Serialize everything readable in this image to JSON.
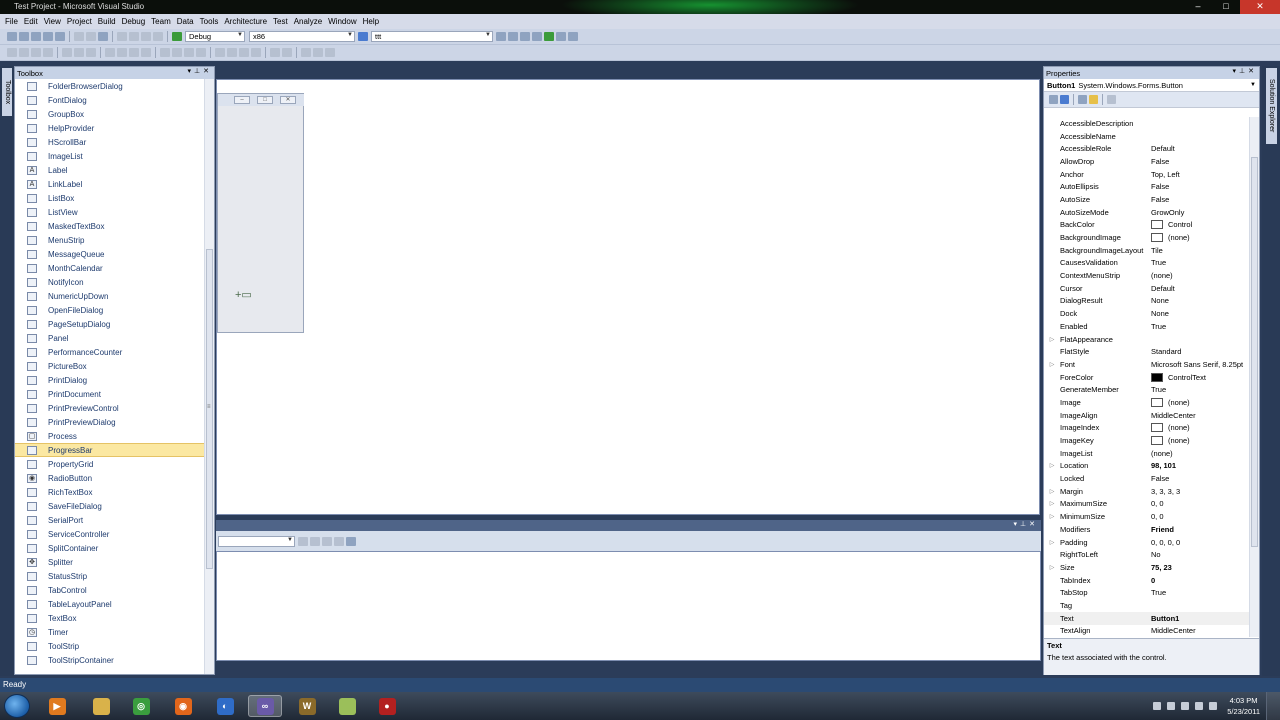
{
  "window": {
    "title": "Test Project - Microsoft Visual Studio"
  },
  "menu": [
    "File",
    "Edit",
    "View",
    "Project",
    "Build",
    "Debug",
    "Team",
    "Data",
    "Tools",
    "Architecture",
    "Test",
    "Analyze",
    "Window",
    "Help"
  ],
  "toolbar": {
    "config": "Debug",
    "platform": "x86",
    "find": "ttt"
  },
  "left_tab": "Toolbox",
  "toolbox": {
    "title": "Toolbox",
    "selected": "ProgressBar",
    "items": [
      {
        "label": "FolderBrowserDialog",
        "icon": "folder-browser-icon"
      },
      {
        "label": "FontDialog",
        "icon": "font-dialog-icon"
      },
      {
        "label": "GroupBox",
        "icon": "groupbox-icon"
      },
      {
        "label": "HelpProvider",
        "icon": "help-provider-icon"
      },
      {
        "label": "HScrollBar",
        "icon": "hscrollbar-icon"
      },
      {
        "label": "ImageList",
        "icon": "imagelist-icon"
      },
      {
        "label": "Label",
        "icon": "label-icon"
      },
      {
        "label": "LinkLabel",
        "icon": "linklabel-icon"
      },
      {
        "label": "ListBox",
        "icon": "listbox-icon"
      },
      {
        "label": "ListView",
        "icon": "listview-icon"
      },
      {
        "label": "MaskedTextBox",
        "icon": "masked-textbox-icon"
      },
      {
        "label": "MenuStrip",
        "icon": "menustrip-icon"
      },
      {
        "label": "MessageQueue",
        "icon": "message-queue-icon"
      },
      {
        "label": "MonthCalendar",
        "icon": "month-calendar-icon"
      },
      {
        "label": "NotifyIcon",
        "icon": "notify-icon-icon"
      },
      {
        "label": "NumericUpDown",
        "icon": "numeric-updown-icon"
      },
      {
        "label": "OpenFileDialog",
        "icon": "open-file-dialog-icon"
      },
      {
        "label": "PageSetupDialog",
        "icon": "page-setup-dialog-icon"
      },
      {
        "label": "Panel",
        "icon": "panel-icon"
      },
      {
        "label": "PerformanceCounter",
        "icon": "performance-counter-icon"
      },
      {
        "label": "PictureBox",
        "icon": "picturebox-icon"
      },
      {
        "label": "PrintDialog",
        "icon": "print-dialog-icon"
      },
      {
        "label": "PrintDocument",
        "icon": "print-document-icon"
      },
      {
        "label": "PrintPreviewControl",
        "icon": "print-preview-control-icon"
      },
      {
        "label": "PrintPreviewDialog",
        "icon": "print-preview-dialog-icon"
      },
      {
        "label": "Process",
        "icon": "process-icon"
      },
      {
        "label": "ProgressBar",
        "icon": "progressbar-icon"
      },
      {
        "label": "PropertyGrid",
        "icon": "property-grid-icon"
      },
      {
        "label": "RadioButton",
        "icon": "radio-button-icon"
      },
      {
        "label": "RichTextBox",
        "icon": "rich-textbox-icon"
      },
      {
        "label": "SaveFileDialog",
        "icon": "save-file-dialog-icon"
      },
      {
        "label": "SerialPort",
        "icon": "serial-port-icon"
      },
      {
        "label": "ServiceController",
        "icon": "service-controller-icon"
      },
      {
        "label": "SplitContainer",
        "icon": "split-container-icon"
      },
      {
        "label": "Splitter",
        "icon": "splitter-icon"
      },
      {
        "label": "StatusStrip",
        "icon": "status-strip-icon"
      },
      {
        "label": "TabControl",
        "icon": "tab-control-icon"
      },
      {
        "label": "TableLayoutPanel",
        "icon": "table-layout-panel-icon"
      },
      {
        "label": "TextBox",
        "icon": "textbox-icon"
      },
      {
        "label": "Timer",
        "icon": "timer-icon"
      },
      {
        "label": "ToolStrip",
        "icon": "toolstrip-icon"
      },
      {
        "label": "ToolStripContainer",
        "icon": "toolstrip-container-icon"
      }
    ]
  },
  "properties": {
    "title": "Properties",
    "object_name": "Button1",
    "object_type": "System.Windows.Forms.Button",
    "rows": [
      {
        "name": "AccessibleDescription",
        "value": "",
        "expand": false,
        "bold": false
      },
      {
        "name": "AccessibleName",
        "value": "",
        "expand": false,
        "bold": false
      },
      {
        "name": "AccessibleRole",
        "value": "Default",
        "expand": false,
        "bold": false
      },
      {
        "name": "AllowDrop",
        "value": "False",
        "expand": false,
        "bold": false
      },
      {
        "name": "Anchor",
        "value": "Top, Left",
        "expand": false,
        "bold": false
      },
      {
        "name": "AutoEllipsis",
        "value": "False",
        "expand": false,
        "bold": false
      },
      {
        "name": "AutoSize",
        "value": "False",
        "expand": false,
        "bold": false
      },
      {
        "name": "AutoSizeMode",
        "value": "GrowOnly",
        "expand": false,
        "bold": false
      },
      {
        "name": "BackColor",
        "value": "Control",
        "expand": false,
        "bold": false,
        "swatch": "#ffffff"
      },
      {
        "name": "BackgroundImage",
        "value": "(none)",
        "expand": false,
        "bold": false,
        "swatch": "#ffffff"
      },
      {
        "name": "BackgroundImageLayout",
        "value": "Tile",
        "expand": false,
        "bold": false
      },
      {
        "name": "CausesValidation",
        "value": "True",
        "expand": false,
        "bold": false
      },
      {
        "name": "ContextMenuStrip",
        "value": "(none)",
        "expand": false,
        "bold": false
      },
      {
        "name": "Cursor",
        "value": "Default",
        "expand": false,
        "bold": false
      },
      {
        "name": "DialogResult",
        "value": "None",
        "expand": false,
        "bold": false
      },
      {
        "name": "Dock",
        "value": "None",
        "expand": false,
        "bold": false
      },
      {
        "name": "Enabled",
        "value": "True",
        "expand": false,
        "bold": false
      },
      {
        "name": "FlatAppearance",
        "value": "",
        "expand": true,
        "bold": false
      },
      {
        "name": "FlatStyle",
        "value": "Standard",
        "expand": false,
        "bold": false
      },
      {
        "name": "Font",
        "value": "Microsoft Sans Serif, 8.25pt",
        "expand": true,
        "bold": false
      },
      {
        "name": "ForeColor",
        "value": "ControlText",
        "expand": false,
        "bold": false,
        "swatch": "#000000"
      },
      {
        "name": "GenerateMember",
        "value": "True",
        "expand": false,
        "bold": false
      },
      {
        "name": "Image",
        "value": "(none)",
        "expand": false,
        "bold": false,
        "swatch": "#ffffff"
      },
      {
        "name": "ImageAlign",
        "value": "MiddleCenter",
        "expand": false,
        "bold": false
      },
      {
        "name": "ImageIndex",
        "value": "(none)",
        "expand": false,
        "bold": false,
        "swatch": "#ffffff"
      },
      {
        "name": "ImageKey",
        "value": "(none)",
        "expand": false,
        "bold": false,
        "swatch": "#ffffff"
      },
      {
        "name": "ImageList",
        "value": "(none)",
        "expand": false,
        "bold": false
      },
      {
        "name": "Location",
        "value": "98, 101",
        "expand": true,
        "bold": true
      },
      {
        "name": "Locked",
        "value": "False",
        "expand": false,
        "bold": false
      },
      {
        "name": "Margin",
        "value": "3, 3, 3, 3",
        "expand": true,
        "bold": false
      },
      {
        "name": "MaximumSize",
        "value": "0, 0",
        "expand": true,
        "bold": false
      },
      {
        "name": "MinimumSize",
        "value": "0, 0",
        "expand": true,
        "bold": false
      },
      {
        "name": "Modifiers",
        "value": "Friend",
        "expand": false,
        "bold": true
      },
      {
        "name": "Padding",
        "value": "0, 0, 0, 0",
        "expand": true,
        "bold": false
      },
      {
        "name": "RightToLeft",
        "value": "No",
        "expand": false,
        "bold": false
      },
      {
        "name": "Size",
        "value": "75, 23",
        "expand": true,
        "bold": true
      },
      {
        "name": "TabIndex",
        "value": "0",
        "expand": false,
        "bold": true
      },
      {
        "name": "TabStop",
        "value": "True",
        "expand": false,
        "bold": false
      },
      {
        "name": "Tag",
        "value": "",
        "expand": false,
        "bold": false
      },
      {
        "name": "Text",
        "value": "Button1",
        "expand": false,
        "bold": true,
        "selected": true
      },
      {
        "name": "TextAlign",
        "value": "MiddleCenter",
        "expand": false,
        "bold": false
      }
    ],
    "description_name": "Text",
    "description_text": "The text associated with the control."
  },
  "right_tab": "Solution Explorer",
  "status": "Ready",
  "clock": {
    "time": "4:03 PM",
    "date": "5/23/2011"
  },
  "taskbar_apps": [
    {
      "name": "media-player",
      "color": "#e07a1f",
      "label": "▶",
      "active": false
    },
    {
      "name": "explorer",
      "color": "#d9b24a",
      "label": "",
      "active": false
    },
    {
      "name": "chrome",
      "color": "#3a9d3e",
      "label": "◎",
      "active": false
    },
    {
      "name": "firefox",
      "color": "#e2661b",
      "label": "◉",
      "active": false
    },
    {
      "name": "globe",
      "color": "#2f6cc7",
      "label": "◐",
      "active": false
    },
    {
      "name": "visual-studio",
      "color": "#6a5aa8",
      "label": "∞",
      "active": true
    },
    {
      "name": "warcraft",
      "color": "#8a6a2a",
      "label": "W",
      "active": false
    },
    {
      "name": "notepad",
      "color": "#9bbf5a",
      "label": "",
      "active": false
    },
    {
      "name": "recorder",
      "color": "#b32020",
      "label": "●",
      "active": false
    }
  ]
}
